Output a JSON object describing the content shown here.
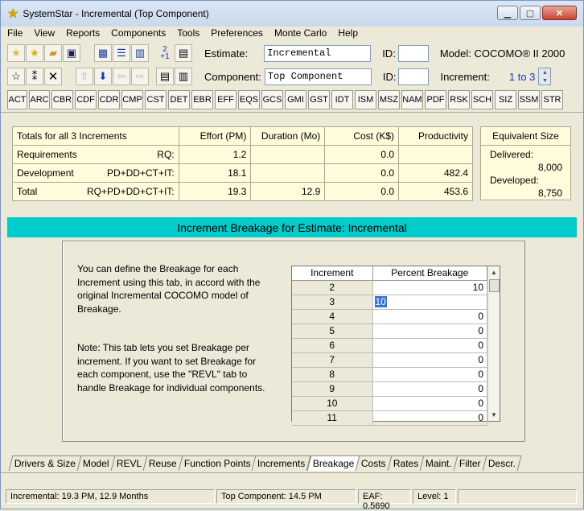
{
  "window": {
    "title": "SystemStar - Incremental (Top Component)",
    "controls": [
      "minimize",
      "maximize",
      "close"
    ]
  },
  "menu": [
    "File",
    "View",
    "Reports",
    "Components",
    "Tools",
    "Preferences",
    "Monte Carlo",
    "Help"
  ],
  "toolbar": {
    "estimate_label": "Estimate:",
    "estimate_value": "Incremental",
    "component_label": "Component:",
    "component_value": "Top Component",
    "id_label": "ID:",
    "id_label2": "ID:",
    "model_text": "Model: COCOMO® II 2000",
    "increment_label": "Increment:",
    "increment_range": "1 to 3",
    "plus_badge_top": "2",
    "plus_badge_bottom": "+1"
  },
  "tab_buttons": [
    "ACT",
    "ARC",
    "CBR",
    "CDF",
    "CDR",
    "CMP",
    "CST",
    "DET",
    "EBR",
    "EFF",
    "EQS",
    "GCS",
    "GMI",
    "GST",
    "IDT",
    "ISM",
    "MSZ",
    "NAM",
    "PDF",
    "RSK",
    "SCH",
    "SIZ",
    "SSM",
    "STR"
  ],
  "totals": {
    "header": [
      "Totals for all 3 Increments",
      "Effort (PM)",
      "Duration (Mo)",
      "Cost (K$)",
      "Productivity"
    ],
    "rows": [
      {
        "name": "Requirements",
        "tag": "RQ:",
        "effort": "1.2",
        "duration": "",
        "cost": "0.0",
        "productivity": ""
      },
      {
        "name": "Development",
        "tag": "PD+DD+CT+IT:",
        "effort": "18.1",
        "duration": "",
        "cost": "0.0",
        "productivity": "482.4"
      },
      {
        "name": "Total",
        "tag": "RQ+PD+DD+CT+IT:",
        "effort": "19.3",
        "duration": "12.9",
        "cost": "0.0",
        "productivity": "453.6"
      }
    ]
  },
  "equivalent_size": {
    "title": "Equivalent Size",
    "delivered_label": "Delivered:",
    "delivered_value": "8,000",
    "developed_label": "Developed:",
    "developed_value": "8,750"
  },
  "breakage": {
    "banner": "Increment Breakage for Estimate: Incremental",
    "desc1": "You can define the Breakage for each Increment using this tab, in accord with the original Incremental COCOMO model of Breakage.",
    "desc2": "Note: This tab lets you set Breakage per increment.  If you want to set Breakage for each component, use the \"REVL\" tab to handle Breakage for individual components.",
    "grid_headers": [
      "Increment",
      "Percent Breakage"
    ],
    "rows": [
      {
        "increment": "2",
        "percent": "10"
      },
      {
        "increment": "3",
        "percent": "10"
      },
      {
        "increment": "4",
        "percent": "0"
      },
      {
        "increment": "5",
        "percent": "0"
      },
      {
        "increment": "6",
        "percent": "0"
      },
      {
        "increment": "7",
        "percent": "0"
      },
      {
        "increment": "8",
        "percent": "0"
      },
      {
        "increment": "9",
        "percent": "0"
      },
      {
        "increment": "10",
        "percent": "0"
      },
      {
        "increment": "11",
        "percent": "0"
      }
    ],
    "selected_row": 1
  },
  "bottom_tabs": [
    "Drivers & Size",
    "Model",
    "REVL",
    "Reuse",
    "Function Points",
    "Increments",
    "Breakage",
    "Costs",
    "Rates",
    "Maint.",
    "Filter",
    "Descr."
  ],
  "active_bottom_tab": "Breakage",
  "status": {
    "left": "Incremental:  19.3 PM,  12.9 Months",
    "mid": "Top Component:  14.5 PM",
    "eaf": "EAF: 0.5690",
    "level": "Level:  1"
  }
}
